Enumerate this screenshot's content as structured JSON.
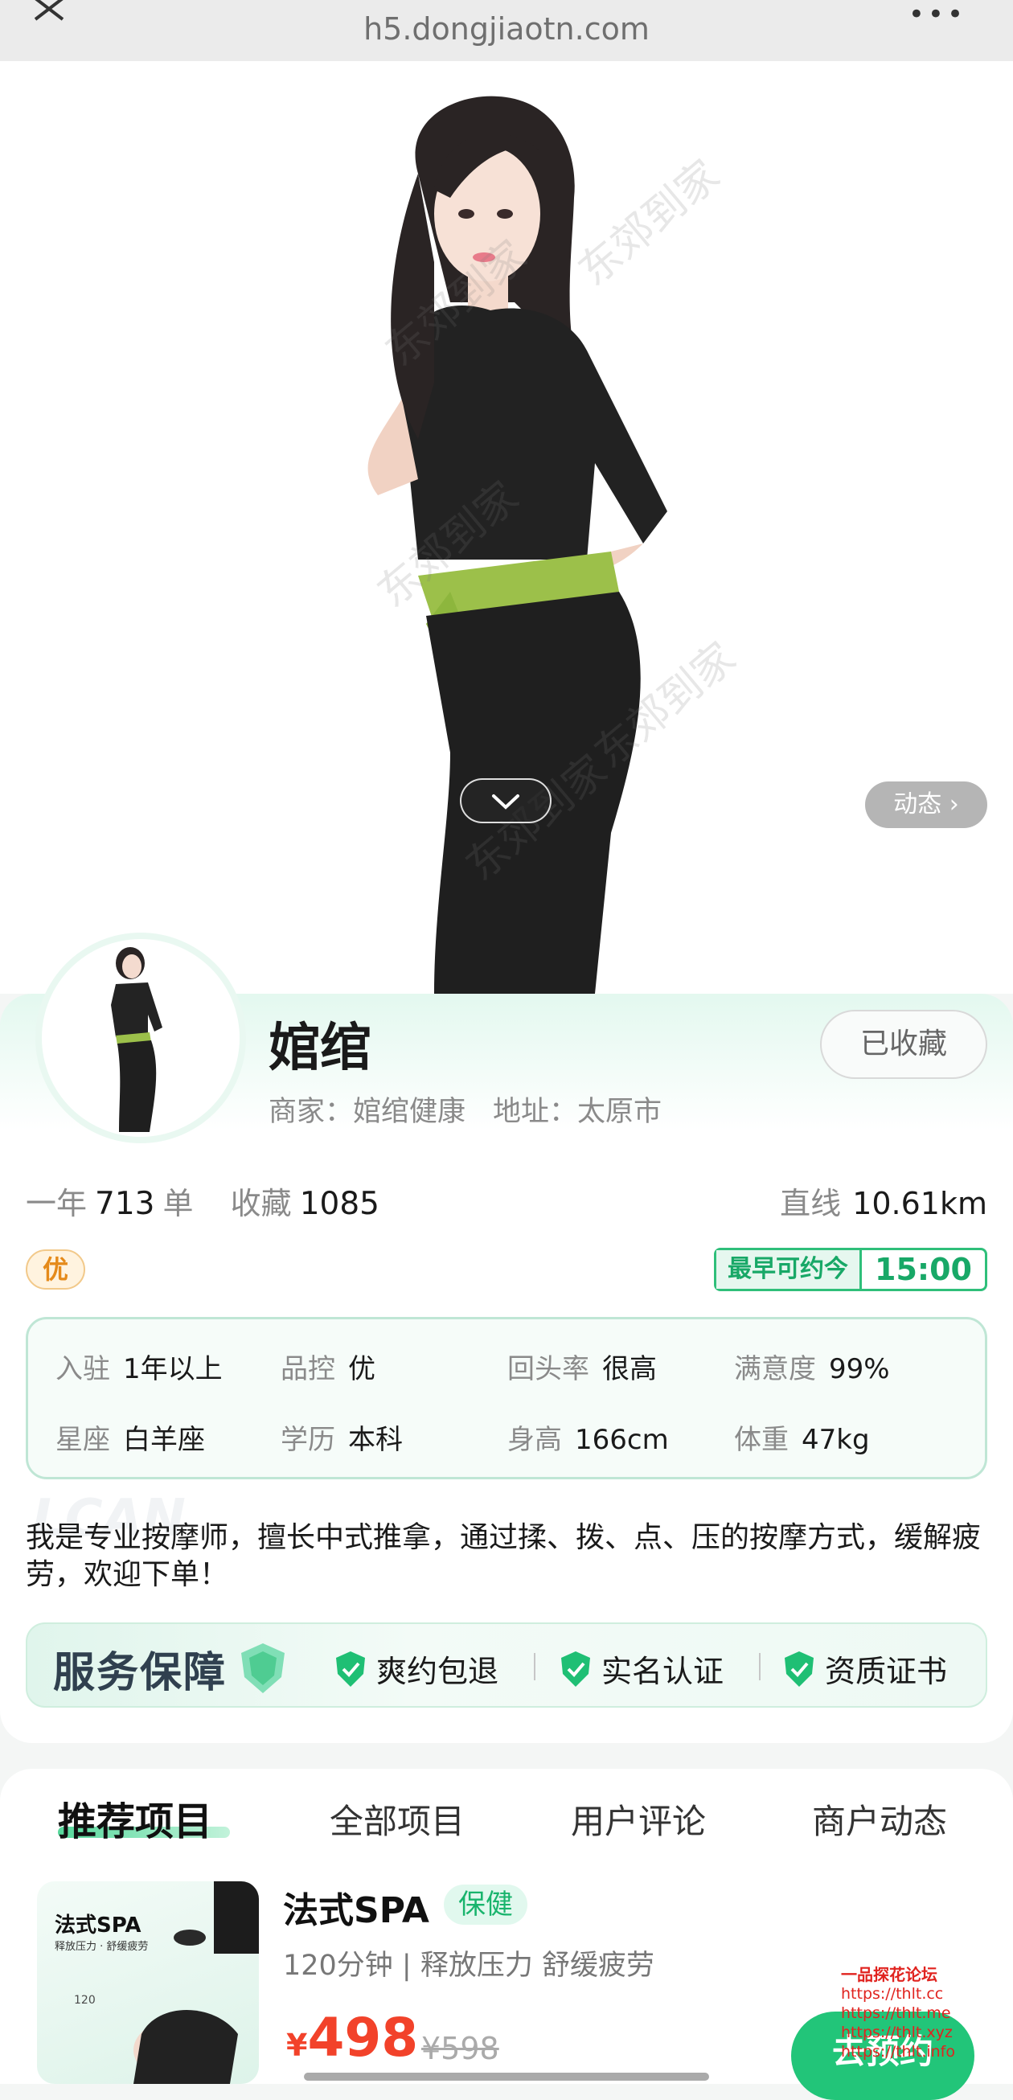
{
  "browser": {
    "url": "h5.dongjiaotn.com",
    "close_icon": "close-icon",
    "more_icon": "more-icon",
    "more_label": "•••"
  },
  "hero": {
    "watermark": "东郊到家",
    "collapse_icon": "chevron-down-icon",
    "dynamic_label": "动态 ›"
  },
  "profile": {
    "name": "婠绾",
    "favorite_label": "已收藏",
    "merchant_label": "商家：",
    "merchant": "婠绾健康",
    "address_label": "地址：",
    "address": "太原市",
    "year_label": "一年",
    "orders": "713",
    "orders_unit": "单",
    "collect_label": "收藏",
    "collects": "1085",
    "distance_label": "直线",
    "distance": "10.61km",
    "badge": "优",
    "earliest_label": "最早可约今",
    "earliest_time": "15:00"
  },
  "info": [
    {
      "k": "入驻",
      "v": "1年以上"
    },
    {
      "k": "品控",
      "v": "优"
    },
    {
      "k": "回头率",
      "v": "很高"
    },
    {
      "k": "满意度",
      "v": "99%"
    },
    {
      "k": "星座",
      "v": "白羊座"
    },
    {
      "k": "学历",
      "v": "本科"
    },
    {
      "k": "身高",
      "v": "166cm"
    },
    {
      "k": "体重",
      "v": "47kg"
    }
  ],
  "bio": "我是专业按摩师，擅长中式推拿，通过揉、拨、点、压的按摩方式，缓解疲劳，欢迎下单！",
  "bio_ghost": "LCAN",
  "service": {
    "title": "服务保障",
    "items": [
      "爽约包退",
      "实名认证",
      "资质证书"
    ]
  },
  "tabs": [
    "推荐项目",
    "全部项目",
    "用户评论",
    "商户动态"
  ],
  "product": {
    "name": "法式SPA",
    "tag": "保健",
    "desc": "120分钟 | 释放压力 舒缓疲劳",
    "currency": "¥",
    "price": "498",
    "old_price": "¥598",
    "book_label": "去预约",
    "image_title": "法式SPA",
    "image_sub": "释放压力 · 舒缓疲劳",
    "image_minutes": "120"
  },
  "forum_watermark": {
    "title": "一品探花论坛",
    "links": [
      "https://thlt.cc",
      "https://thlt.me",
      "https://thlt.xyz",
      "https://thlt.info"
    ]
  },
  "colors": {
    "accent": "#22c579",
    "price": "#f2422a",
    "badge": "#e58a1a"
  }
}
